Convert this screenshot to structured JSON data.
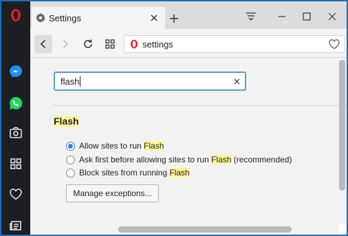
{
  "tab": {
    "title": "Settings"
  },
  "address": {
    "text": "settings"
  },
  "search": {
    "value": "flash"
  },
  "section": {
    "title": "Flash"
  },
  "options": [
    {
      "pre": "Allow sites to run ",
      "hl": "Flash",
      "post": "",
      "checked": true
    },
    {
      "pre": "Ask first before allowing sites to run ",
      "hl": "Flash",
      "post": " (recommended)",
      "checked": false
    },
    {
      "pre": "Block sites from running ",
      "hl": "Flash",
      "post": "",
      "checked": false
    }
  ],
  "manage_button": "Manage exceptions...",
  "colors": {
    "sidebar": "#1c1e22",
    "opera_red": "#e0202b",
    "accent": "#3b7dd8",
    "highlight": "#fff59d",
    "desktop": "#1f6fb5"
  },
  "icons": [
    "opera-logo-icon",
    "messenger-icon",
    "whatsapp-icon",
    "camera-icon",
    "speed-dial-icon",
    "heart-icon",
    "news-icon",
    "gear-icon",
    "close-icon",
    "plus-icon",
    "menu-icon",
    "minimize-icon",
    "maximize-icon",
    "back-icon",
    "forward-icon",
    "reload-icon",
    "grid-icon"
  ]
}
